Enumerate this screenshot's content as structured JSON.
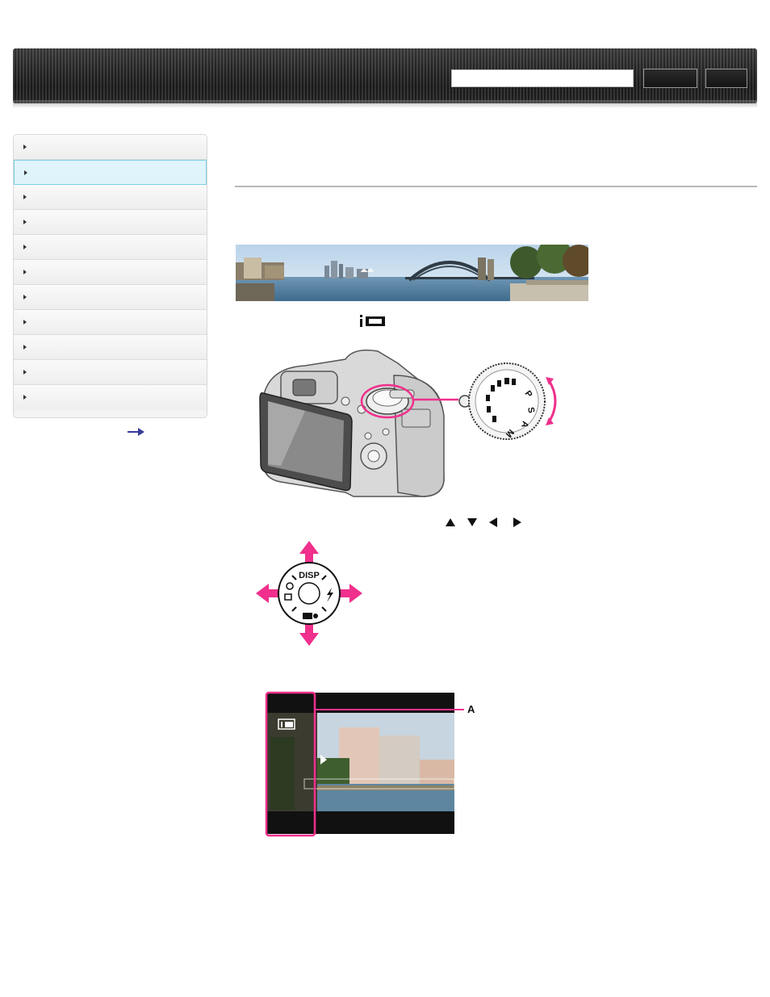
{
  "header": {
    "search_placeholder": "",
    "search_button_label": "",
    "print_button_label": ""
  },
  "sidebar": {
    "items": [
      {
        "label": "",
        "active": false
      },
      {
        "label": "",
        "active": true
      },
      {
        "label": "",
        "active": false
      },
      {
        "label": "",
        "active": false
      },
      {
        "label": "",
        "active": false
      },
      {
        "label": "",
        "active": false
      },
      {
        "label": "",
        "active": false
      },
      {
        "label": "",
        "active": false
      },
      {
        "label": "",
        "active": false
      },
      {
        "label": "",
        "active": false
      },
      {
        "label": "",
        "active": false
      }
    ],
    "more_link_icon": "right-arrow-icon"
  },
  "main": {
    "title": "",
    "mode_icon": "intelligent-sweep-panorama-icon",
    "arrow_key_icons": [
      "up-triangle-icon",
      "down-triangle-icon",
      "left-triangle-icon",
      "right-triangle-icon"
    ],
    "control_wheel_text": "DISP",
    "mode_dial_letters": [
      "P",
      "S",
      "A",
      "M"
    ],
    "screen_callout_label": "A",
    "accent_color": "#f0308c"
  }
}
